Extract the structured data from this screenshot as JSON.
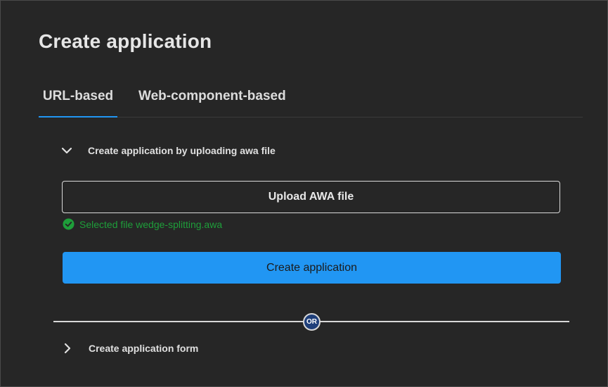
{
  "dialog": {
    "title": "Create application"
  },
  "tabs": [
    {
      "label": "URL-based",
      "active": true
    },
    {
      "label": "Web-component-based",
      "active": false
    }
  ],
  "upload_section": {
    "header_label": "Create application by uploading awa file",
    "expanded": true,
    "upload_button_label": "Upload AWA file",
    "status_text": "Selected file wedge-splitting.awa",
    "create_button_label": "Create application"
  },
  "divider": {
    "label": "OR"
  },
  "form_section": {
    "header_label": "Create application form",
    "expanded": false
  },
  "colors": {
    "background": "#262626",
    "accent": "#2196f3",
    "success": "#1e9e3a",
    "or_badge": "#1f3f7a"
  },
  "icons": {
    "upload_section_toggle": "chevron-down-icon",
    "form_section_toggle": "chevron-right-icon",
    "status": "check-circle-icon"
  }
}
